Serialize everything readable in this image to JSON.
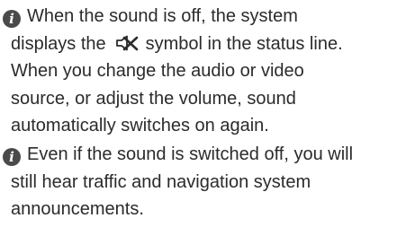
{
  "notes": [
    {
      "icon": "info-icon",
      "line1": "When the sound is off, the system",
      "line2_before": "displays the",
      "line2_symbol": "speaker-muted-icon",
      "line2_after": "symbol in the status line.",
      "line3": "When you change the audio or video",
      "line4": "source, or adjust the volume, sound",
      "line5": "automatically switches on again."
    },
    {
      "icon": "info-icon",
      "line1": "Even if the sound is switched off, you will",
      "line2": "still hear traffic and navigation system",
      "line3": "announcements."
    }
  ],
  "colors": {
    "text": "#2b2b2b",
    "icon_bg": "#4a4a4a"
  }
}
